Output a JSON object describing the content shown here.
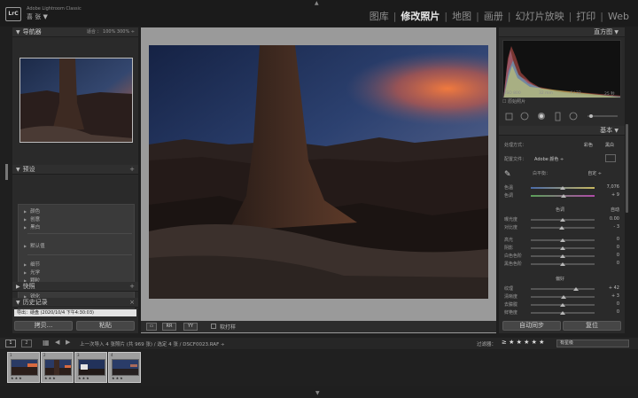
{
  "app": {
    "logo_text": "LrC",
    "product_name": "Adobe Lightroom Classic",
    "user_name": "喜 张  ▼"
  },
  "modules": [
    {
      "label": "图库",
      "active": false
    },
    {
      "label": "修改照片",
      "active": true
    },
    {
      "label": "地图",
      "active": false
    },
    {
      "label": "画册",
      "active": false
    },
    {
      "label": "幻灯片放映",
      "active": false
    },
    {
      "label": "打印",
      "active": false
    },
    {
      "label": "Web",
      "active": false
    }
  ],
  "left_panel": {
    "navigator": {
      "title": "导航器",
      "zoom_options": "适合 ：  100%    300%  ÷"
    },
    "presets": {
      "title": "预设",
      "groups_a": [
        "颜色",
        "创意",
        "黑白"
      ],
      "group_b": "默认值",
      "groups_c": [
        "细节",
        "光学",
        "颗粒",
        "曲线",
        "锐化"
      ]
    },
    "snapshots_title": "快照",
    "history": {
      "title": "历史记录",
      "close": "×",
      "entry": "导出：硬盘 (2020/10/4 下午4:30:03)"
    },
    "copy_button": "拷贝...",
    "paste_button": "粘贴"
  },
  "center": {
    "toolbar": {
      "view_btn1": "▭",
      "view_btn2": "RR",
      "view_btn3": "YY",
      "soft_proof_label": "软打样"
    }
  },
  "right_panel": {
    "histogram": {
      "title": "直方图",
      "iso": "ISO 800",
      "focal": "32 mm",
      "aperture": "f / 22",
      "shutter": "25 秒",
      "original_label": "☐ 原始照片"
    },
    "basic": {
      "title": "基本",
      "treatment_label": "处理方式：",
      "treatment_color": "彩色",
      "treatment_bw": "黑白",
      "profile_label": "配置文件：",
      "profile_value": "Adobe 颜色 ÷",
      "wb_label": "白平衡：",
      "wb_value": "自定 ÷",
      "temp_label": "色温",
      "temp_value": "7,076",
      "tint_label": "色调",
      "tint_value": "+ 9",
      "tone_title": "色调",
      "tone_auto": "自动",
      "exposure_label": "曝光度",
      "exposure_value": "0.00",
      "contrast_label": "对比度",
      "contrast_value": "- 3",
      "highlights_label": "高光",
      "highlights_value": "0",
      "shadows_label": "阴影",
      "shadows_value": "0",
      "whites_label": "白色色阶",
      "whites_value": "0",
      "blacks_label": "黑色色阶",
      "blacks_value": "0",
      "presence_title": "偏好",
      "texture_label": "纹理",
      "texture_value": "+ 42",
      "clarity_label": "清晰度",
      "clarity_value": "+ 3",
      "dehaze_label": "去朦胧",
      "dehaze_value": "0",
      "vibrance_label": "鲜艳度",
      "vibrance_value": "0"
    },
    "sync_button": "自动同步",
    "reset_button": "复位"
  },
  "filmstrip_bar": {
    "page1": "1",
    "page2": "2",
    "source_info": "上一次导入   4 张照片 (共 969 张) / 选定 4 张 / DSCF0023.RAF ÷",
    "filter_label": "过滤器：",
    "stars": "≥  ★ ★ ★ ★ ★",
    "filter_value": "有星级"
  },
  "filmstrip": [
    {
      "index": "1",
      "rating": "★★★"
    },
    {
      "index": "2",
      "rating": "★★★"
    },
    {
      "index": "3",
      "rating": "★★★"
    },
    {
      "index": "4",
      "rating": "★★★"
    }
  ],
  "colors": {
    "sky_top": "#20304f",
    "sky_glow": "#e8683a",
    "rock": "#3a2a22",
    "panel_bg": "#2a2a2a"
  }
}
